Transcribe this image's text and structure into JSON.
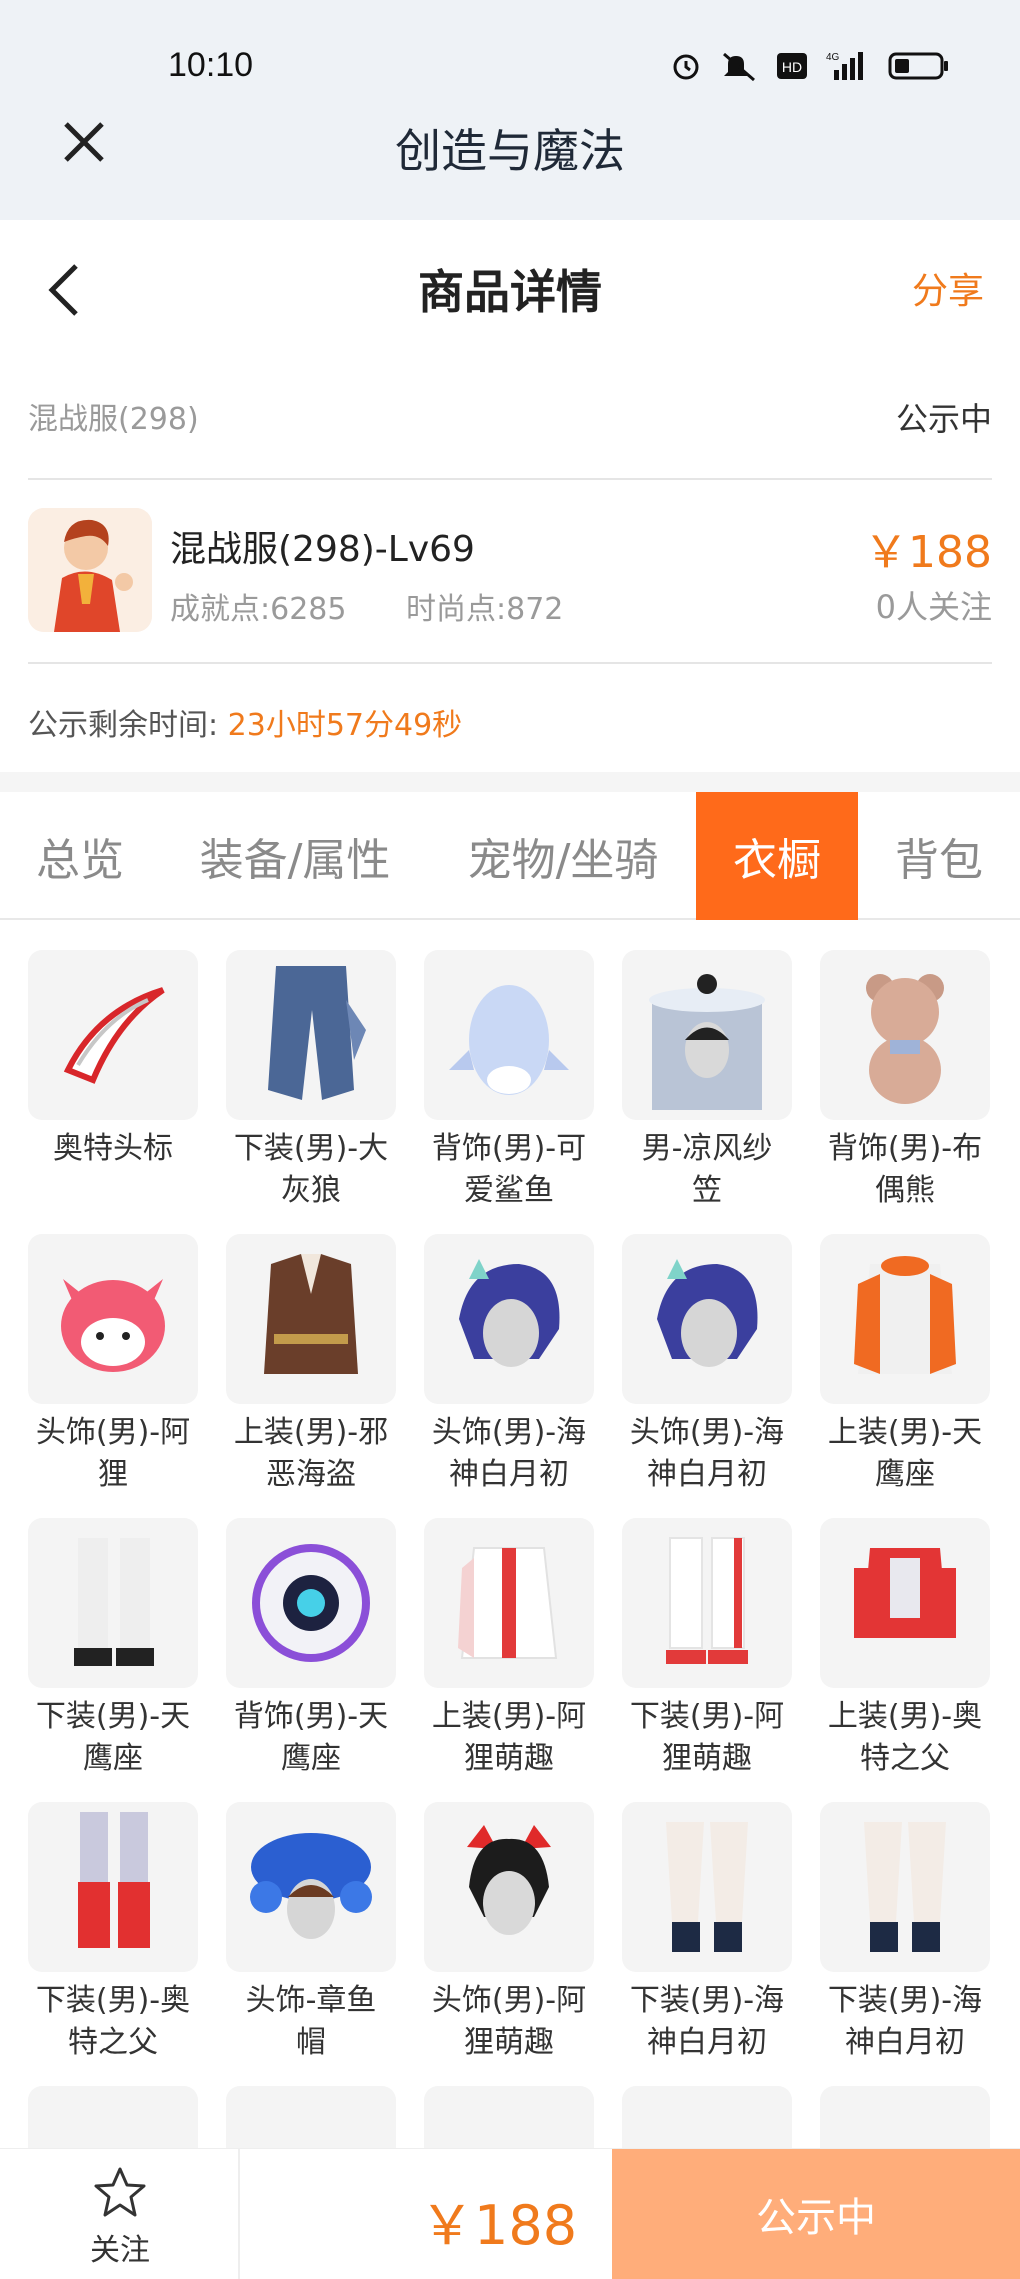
{
  "status_bar": {
    "time": "10:10",
    "icons": [
      "alarm-icon",
      "mute-icon",
      "hd-icon",
      "signal-4g-icon",
      "battery-icon"
    ]
  },
  "nav": {
    "title": "创造与魔法",
    "close_icon": "close-icon"
  },
  "header": {
    "title": "商品详情",
    "share": "分享",
    "back_icon": "chevron-left-icon"
  },
  "server": {
    "name": "混战服(298)",
    "status": "公示中"
  },
  "item": {
    "title": "混战服(298)-Lv69",
    "achievement": "成就点:6285",
    "fashion": "时尚点:872",
    "price": "￥188",
    "followers": "0人关注"
  },
  "countdown": {
    "label": "公示剩余时间:",
    "value": "23小时57分49秒"
  },
  "tabs": [
    {
      "label": "总览"
    },
    {
      "label": "装备/属性"
    },
    {
      "label": "宠物/坐骑"
    },
    {
      "label": "衣橱",
      "active": true
    },
    {
      "label": "背包"
    }
  ],
  "wardrobe": [
    {
      "line1": "奥特头标",
      "line2": ""
    },
    {
      "line1": "下装(男)-大",
      "line2": "灰狼"
    },
    {
      "line1": "背饰(男)-可",
      "line2": "爱鲨鱼"
    },
    {
      "line1": "男-凉风纱",
      "line2": "笠"
    },
    {
      "line1": "背饰(男)-布",
      "line2": "偶熊"
    },
    {
      "line1": "头饰(男)-阿",
      "line2": "狸"
    },
    {
      "line1": "上装(男)-邪",
      "line2": "恶海盗"
    },
    {
      "line1": "头饰(男)-海",
      "line2": "神白月初"
    },
    {
      "line1": "头饰(男)-海",
      "line2": "神白月初"
    },
    {
      "line1": "上装(男)-天",
      "line2": "鹰座"
    },
    {
      "line1": "下装(男)-天",
      "line2": "鹰座"
    },
    {
      "line1": "背饰(男)-天",
      "line2": "鹰座"
    },
    {
      "line1": "上装(男)-阿",
      "line2": "狸萌趣"
    },
    {
      "line1": "下装(男)-阿",
      "line2": "狸萌趣"
    },
    {
      "line1": "上装(男)-奥",
      "line2": "特之父"
    },
    {
      "line1": "下装(男)-奥",
      "line2": "特之父"
    },
    {
      "line1": "头饰-章鱼",
      "line2": "帽"
    },
    {
      "line1": "头饰(男)-阿",
      "line2": "狸萌趣"
    },
    {
      "line1": "下装(男)-海",
      "line2": "神白月初"
    },
    {
      "line1": "下装(男)-海",
      "line2": "神白月初"
    }
  ],
  "bottom": {
    "follow": "关注",
    "price": "￥188",
    "cta": "公示中",
    "star_icon": "star-icon"
  },
  "colors": {
    "accent": "#ff6a1a",
    "price": "#f07a1c",
    "cta_bg": "#ffad7a"
  }
}
